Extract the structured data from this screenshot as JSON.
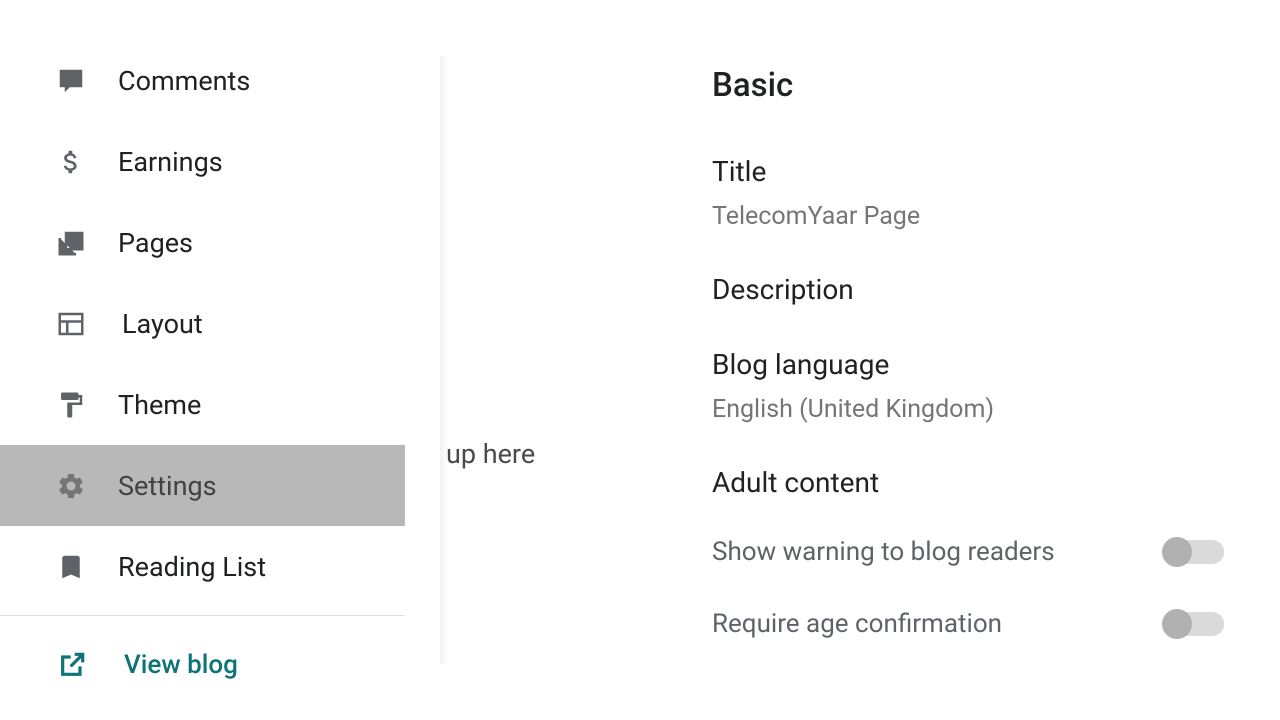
{
  "sidebar": {
    "items": [
      {
        "label": "Comments",
        "icon": "comments"
      },
      {
        "label": "Earnings",
        "icon": "dollar"
      },
      {
        "label": "Pages",
        "icon": "pages"
      },
      {
        "label": "Layout",
        "icon": "layout"
      },
      {
        "label": "Theme",
        "icon": "theme"
      },
      {
        "label": "Settings",
        "icon": "gear"
      },
      {
        "label": "Reading List",
        "icon": "bookmark"
      }
    ],
    "view_blog_label": "View blog"
  },
  "background_text": "up here",
  "main": {
    "heading": "Basic",
    "title_label": "Title",
    "title_value": "TelecomYaar Page",
    "description_label": "Description",
    "language_label": "Blog language",
    "language_value": "English (United Kingdom)",
    "adult_heading": "Adult content",
    "toggle1_label": "Show warning to blog readers",
    "toggle2_label": "Require age confirmation"
  }
}
